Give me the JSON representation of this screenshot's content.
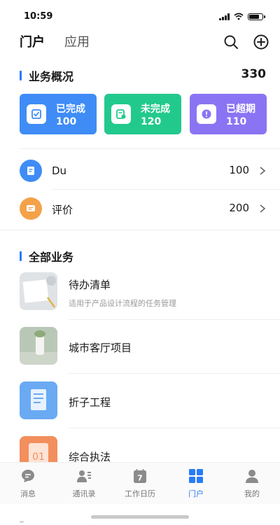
{
  "status_bar": {
    "time": "10:59"
  },
  "nav": {
    "active_tab": "门户",
    "inactive_tab": "应用"
  },
  "overview": {
    "title": "业务概况",
    "total": "330",
    "cards": [
      {
        "label": "已完成",
        "value": "100",
        "color": "#3f8cf7"
      },
      {
        "label": "未完成",
        "value": "120",
        "color": "#22c98d"
      },
      {
        "label": "已超期",
        "value": "110",
        "color": "#8a74f3"
      }
    ]
  },
  "list": [
    {
      "name": "Du",
      "value": "100",
      "icon": "document-icon",
      "color": "#3f8cf7"
    },
    {
      "name": "评价",
      "value": "200",
      "icon": "comment-icon",
      "color": "#f4a24a"
    }
  ],
  "all_business": {
    "title": "全部业务",
    "items": [
      {
        "title": "待办清单",
        "subtitle": "适用于产品设计流程的任务管理"
      },
      {
        "title": "城市客厅项目",
        "subtitle": ""
      },
      {
        "title": "折子工程",
        "subtitle": ""
      },
      {
        "title": "综合执法",
        "subtitle": ""
      }
    ]
  },
  "tabbar": {
    "items": [
      {
        "label": "消息",
        "icon": "message-icon"
      },
      {
        "label": "通讯录",
        "icon": "contacts-icon"
      },
      {
        "label": "工作日历",
        "icon": "calendar-icon",
        "date": "7"
      },
      {
        "label": "门户",
        "icon": "grid-icon",
        "active": true
      },
      {
        "label": "我的",
        "icon": "person-icon"
      }
    ]
  },
  "colors": {
    "accent": "#2a7bf6",
    "thumb_orange": "01"
  }
}
